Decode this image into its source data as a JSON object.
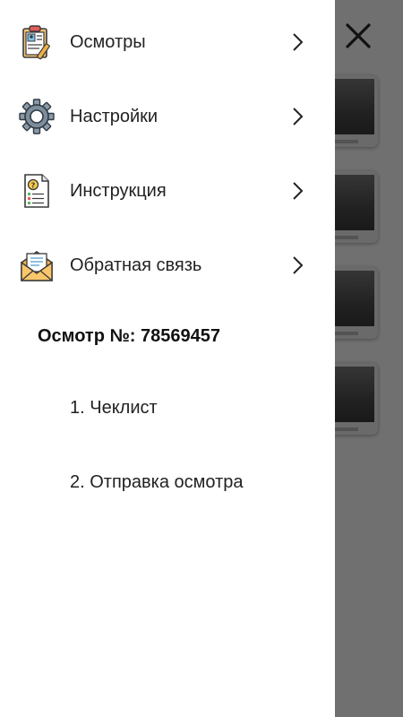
{
  "menu": {
    "items": [
      {
        "label": "Осмотры",
        "icon": "clipboard-icon"
      },
      {
        "label": "Настройки",
        "icon": "gear-icon"
      },
      {
        "label": "Инструкция",
        "icon": "document-question-icon"
      },
      {
        "label": "Обратная связь",
        "icon": "envelope-icon"
      }
    ]
  },
  "inspection": {
    "title": "Осмотр №: 78569457",
    "steps": [
      {
        "label": "1. Чеклист"
      },
      {
        "label": "2. Отправка осмотра"
      }
    ]
  },
  "colors": {
    "scrim": "#6b6b6b",
    "drawer_bg": "#ffffff",
    "text": "#222222"
  }
}
